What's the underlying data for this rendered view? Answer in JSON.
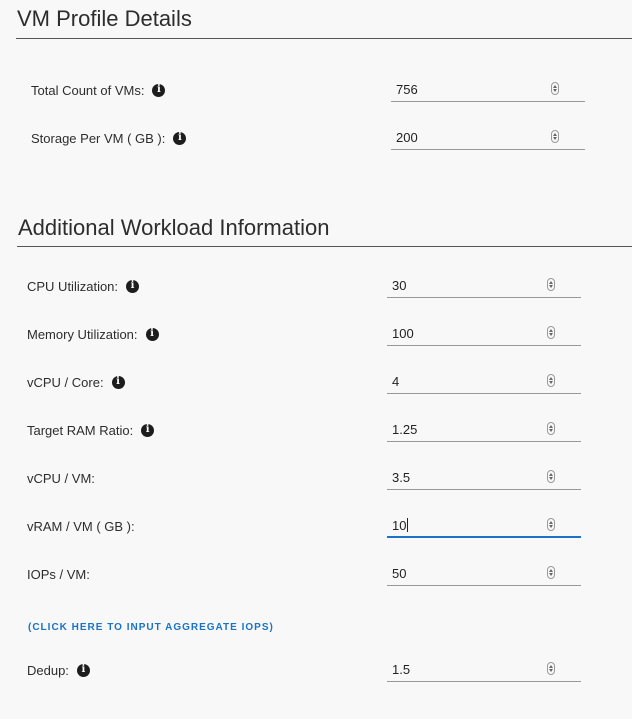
{
  "vm_profile": {
    "title": "VM Profile Details",
    "fields": {
      "total_vms": {
        "label": "Total Count of VMs:",
        "value": "756"
      },
      "storage_per_vm": {
        "label": "Storage Per VM ( GB ):",
        "value": "200"
      }
    }
  },
  "workload": {
    "title": "Additional Workload Information",
    "fields": {
      "cpu_utilization": {
        "label": "CPU Utilization:",
        "value": "30"
      },
      "memory_utilization": {
        "label": "Memory Utilization:",
        "value": "100"
      },
      "vcpu_core": {
        "label": "vCPU / Core:",
        "value": "4"
      },
      "target_ram_ratio": {
        "label": "Target RAM Ratio:",
        "value": "1.25"
      },
      "vcpu_vm": {
        "label": "vCPU / VM:",
        "value": "3.5"
      },
      "vram_vm": {
        "label": "vRAM / VM ( GB ):",
        "value": "10"
      },
      "iops_vm": {
        "label": "IOPs / VM:",
        "value": "50"
      },
      "dedup": {
        "label": "Dedup:",
        "value": "1.5"
      }
    },
    "aggregate_iops_link": "(CLICK HERE TO INPUT AGGREGATE IOPS)"
  },
  "info_icon_glyph": "i",
  "icons": {
    "info": "info-circle-icon",
    "spinner": "spinner-arrows-icon"
  },
  "colors": {
    "background": "#f8f8f8",
    "focus_underline": "#1a73c6",
    "link": "#1a73c6"
  }
}
